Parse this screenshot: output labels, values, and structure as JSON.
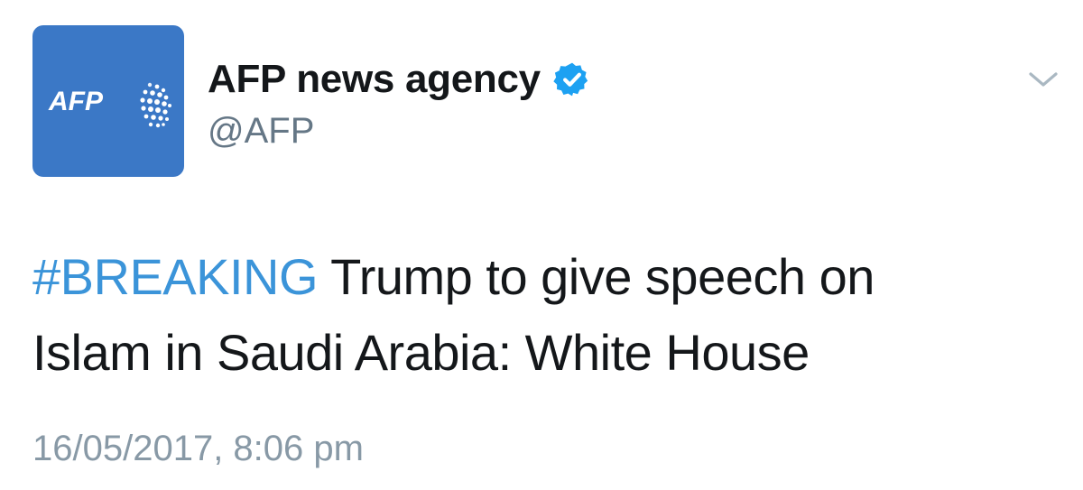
{
  "author": {
    "display_name": "AFP news agency",
    "handle": "@AFP",
    "verified": true,
    "avatar_logo_text": "AFP",
    "avatar_color": "#3b78c6"
  },
  "icons": {
    "verified": "verified-badge-icon",
    "menu": "chevron-down-icon"
  },
  "tweet": {
    "hashtag": "#BREAKING",
    "text_line1": " Trump to give speech on",
    "text_line2": "Islam in Saudi Arabia: White House",
    "timestamp": "16/05/2017, 8:06 pm"
  },
  "colors": {
    "hashtag": "#3b94d9",
    "verified_badge": "#1da1f2",
    "secondary_text": "#657786",
    "timestamp": "#8899a6"
  }
}
